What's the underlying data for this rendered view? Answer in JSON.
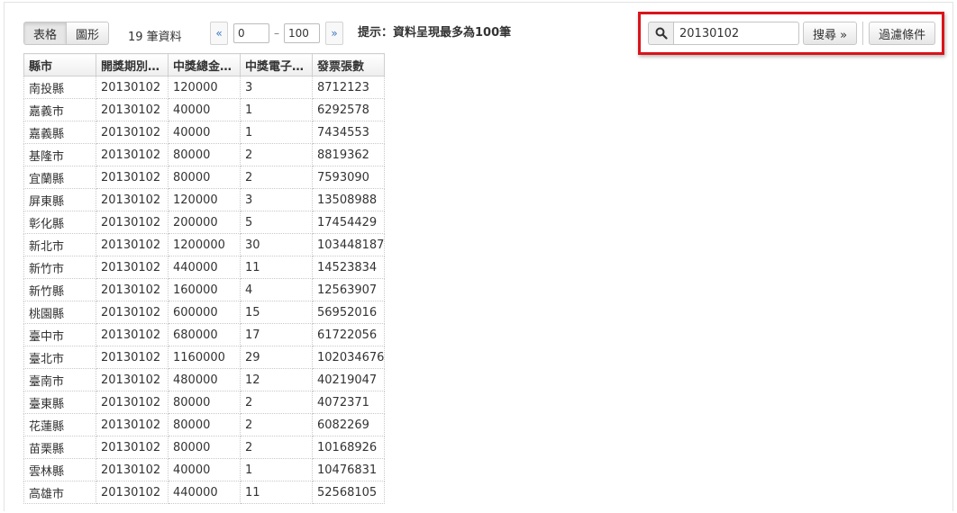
{
  "view_toggle": {
    "table_label": "表格",
    "chart_label": "圖形"
  },
  "record_count": "19 筆資料",
  "pager": {
    "prev_label": "«",
    "next_label": "»",
    "from_value": "0",
    "to_value": "100",
    "separator": "–"
  },
  "hint": "提示：資料呈現最多為100筆",
  "search": {
    "value": "20130102",
    "search_label": "搜尋 »",
    "filter_label": "過濾條件"
  },
  "table": {
    "columns": [
      "縣市",
      "開獎期別…",
      "中獎總金…",
      "中獎電子…",
      "發票張數"
    ],
    "rows": [
      [
        "南投縣",
        "20130102",
        "120000",
        "3",
        "8712123"
      ],
      [
        "嘉義市",
        "20130102",
        "40000",
        "1",
        "6292578"
      ],
      [
        "嘉義縣",
        "20130102",
        "40000",
        "1",
        "7434553"
      ],
      [
        "基隆市",
        "20130102",
        "80000",
        "2",
        "8819362"
      ],
      [
        "宜蘭縣",
        "20130102",
        "80000",
        "2",
        "7593090"
      ],
      [
        "屏東縣",
        "20130102",
        "120000",
        "3",
        "13508988"
      ],
      [
        "彰化縣",
        "20130102",
        "200000",
        "5",
        "17454429"
      ],
      [
        "新北市",
        "20130102",
        "1200000",
        "30",
        "103448187"
      ],
      [
        "新竹市",
        "20130102",
        "440000",
        "11",
        "14523834"
      ],
      [
        "新竹縣",
        "20130102",
        "160000",
        "4",
        "12563907"
      ],
      [
        "桃園縣",
        "20130102",
        "600000",
        "15",
        "56952016"
      ],
      [
        "臺中市",
        "20130102",
        "680000",
        "17",
        "61722056"
      ],
      [
        "臺北市",
        "20130102",
        "1160000",
        "29",
        "102034676"
      ],
      [
        "臺南市",
        "20130102",
        "480000",
        "12",
        "40219047"
      ],
      [
        "臺東縣",
        "20130102",
        "80000",
        "2",
        "4072371"
      ],
      [
        "花蓮縣",
        "20130102",
        "80000",
        "2",
        "6082269"
      ],
      [
        "苗栗縣",
        "20130102",
        "80000",
        "2",
        "10168926"
      ],
      [
        "雲林縣",
        "20130102",
        "40000",
        "1",
        "10476831"
      ],
      [
        "高雄市",
        "20130102",
        "440000",
        "11",
        "52568105"
      ]
    ]
  },
  "colors": {
    "highlight_border": "#d9141b",
    "link": "#3a78c3"
  }
}
